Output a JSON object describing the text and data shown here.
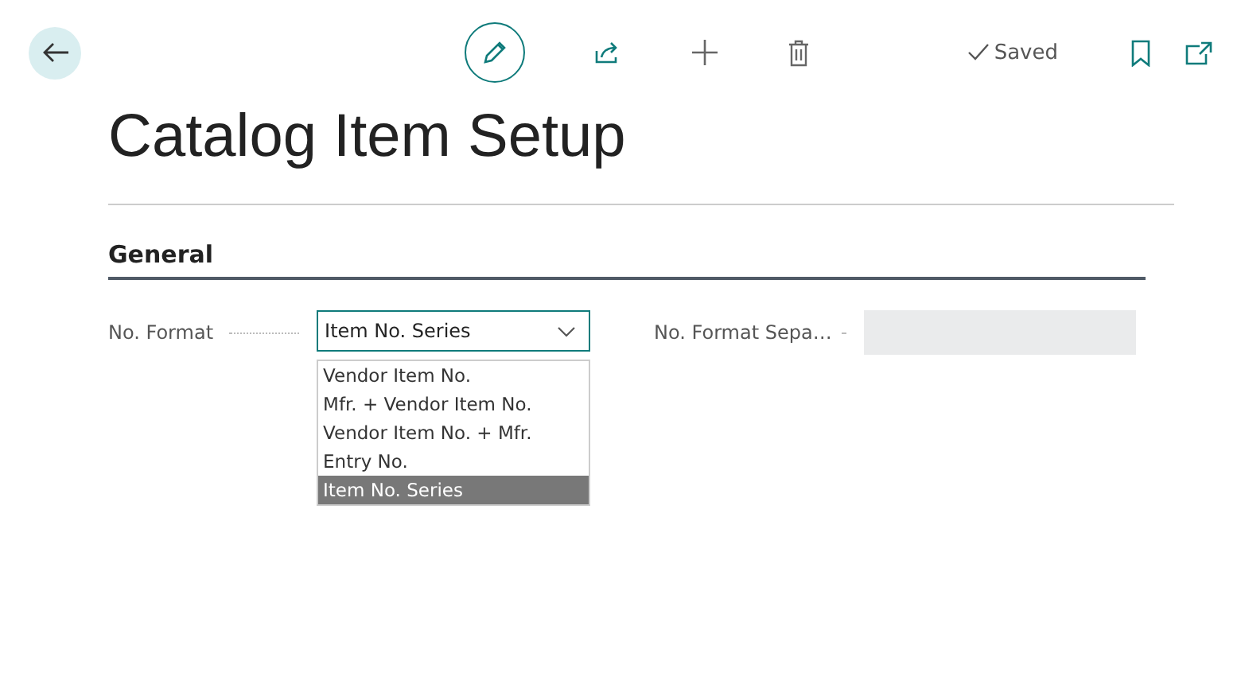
{
  "toolbar": {
    "status": "Saved"
  },
  "page": {
    "title": "Catalog Item Setup"
  },
  "section": {
    "title": "General"
  },
  "fields": [
    {
      "kind": "select",
      "label": "No. Format",
      "value": "Item No. Series",
      "expanded": true,
      "options": [
        {
          "label": "Vendor Item No.",
          "selected": false
        },
        {
          "label": "Mfr. + Vendor Item No.",
          "selected": false
        },
        {
          "label": "Vendor Item No. + Mfr.",
          "selected": false
        },
        {
          "label": "Entry No.",
          "selected": false
        },
        {
          "label": "Item No. Series",
          "selected": true
        }
      ]
    },
    {
      "kind": "text",
      "label": "No. Format Sepa…",
      "disabled": true
    }
  ]
}
